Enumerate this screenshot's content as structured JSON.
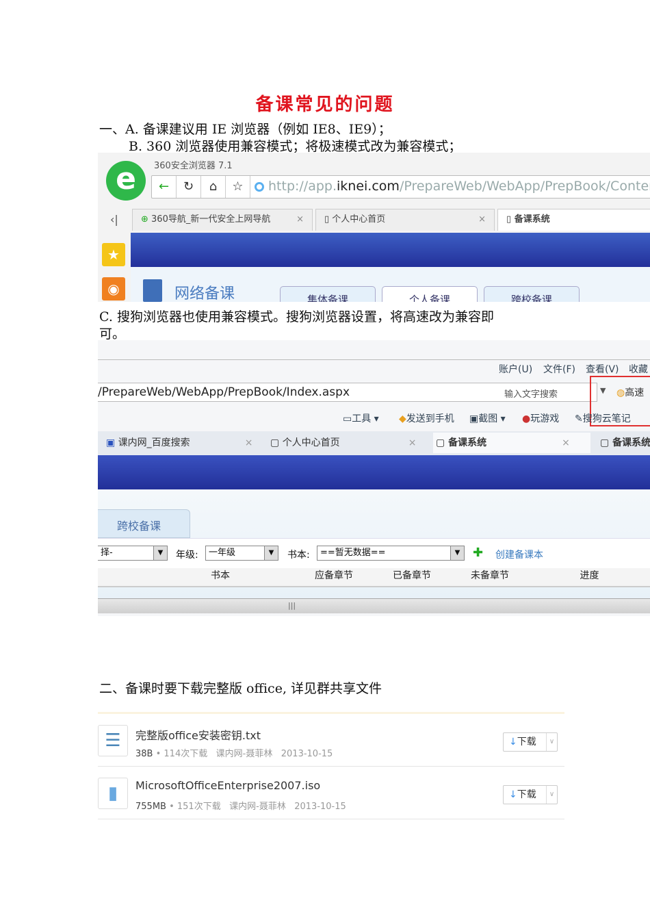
{
  "title": "备课常见的问题",
  "section1": {
    "line_a": "一、A. 备课建议用 IE 浏览器（例如 IE8、IE9）；",
    "line_b": "B. 360 浏览器使用兼容模式；将极速模式改为兼容模式；",
    "line_c1": "C. 搜狗浏览器也使用兼容模式。搜狗浏览器设置，将高速改为兼容即",
    "line_c2": "可。"
  },
  "screenshot360": {
    "browser_title": "360安全浏览器 7.1",
    "url_prefix": "http://app.",
    "url_domain": "iknei.com",
    "url_rest": "/PrepareWeb/WebApp/PrepBook/Content",
    "tabs": [
      "360导航_新一代安全上网导航",
      "个人中心首页",
      "备课系统"
    ],
    "site_name": "网络备课",
    "nav_tabs": [
      "集体备课",
      "个人备课",
      "跨校备课"
    ]
  },
  "screenshotSogou": {
    "menu": [
      "账户(U)",
      "文件(F)",
      "查看(V)",
      "收藏"
    ],
    "url": "/PrepareWeb/WebApp/PrepBook/Index.aspx",
    "search_placeholder": "输入文字搜索",
    "mode": "高速",
    "toolbar": [
      "工具",
      "发送到手机",
      "截图",
      "玩游戏",
      "搜狗云笔记"
    ],
    "tabs": [
      "课内网_百度搜索",
      "个人中心首页",
      "备课系统",
      "备课系统"
    ],
    "nav_tab": "跨校备课",
    "filter_first": "择-",
    "grade_label": "年级:",
    "grade_value": "一年级",
    "book_label": "书本:",
    "book_value": "==暂无数据==",
    "create_label": "创建备课本",
    "columns": [
      "书本",
      "应备章节",
      "已备章节",
      "未备章节",
      "进度"
    ]
  },
  "section2": {
    "heading": "二、备课时要下载完整版 office, 详见群共享文件"
  },
  "files": [
    {
      "name": "完整版office安装密钥.txt",
      "size": "38B",
      "downloads": "114次下载",
      "owner": "课内网-聂菲林",
      "date": "2013-10-15",
      "button": "下载"
    },
    {
      "name": "MicrosoftOfficeEnterprise2007.iso",
      "size": "755MB",
      "downloads": "151次下载",
      "owner": "课内网-聂菲林",
      "date": "2013-10-15",
      "button": "下载"
    }
  ]
}
